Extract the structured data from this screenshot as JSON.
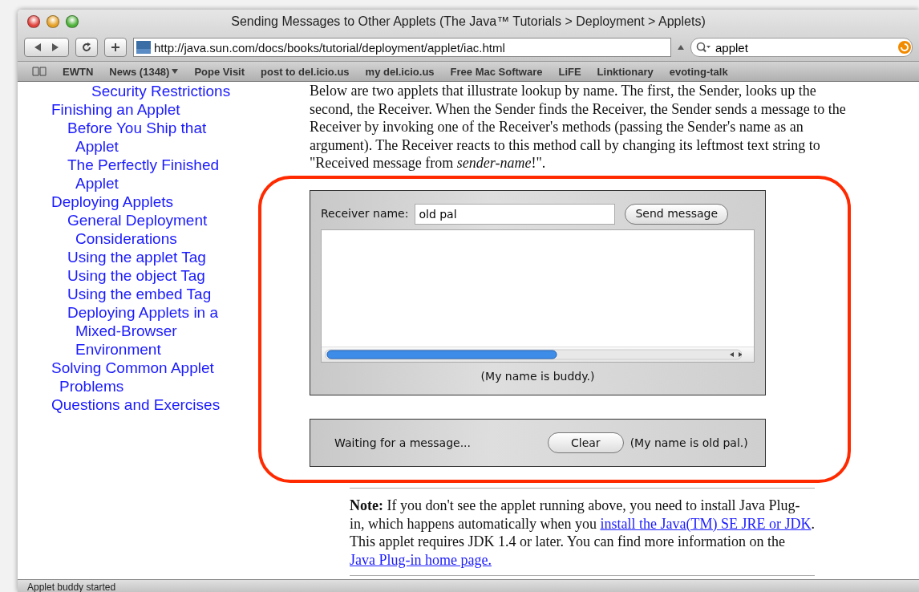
{
  "window": {
    "title": "Sending Messages to Other Applets (The Java™ Tutorials > Deployment > Applets)"
  },
  "toolbar": {
    "url": "http://java.sun.com/docs/books/tutorial/deployment/applet/iac.html",
    "search": "applet"
  },
  "bookmarks": [
    {
      "label": "EWTN",
      "menu": false
    },
    {
      "label": "News (1348)",
      "menu": true
    },
    {
      "label": "Pope Visit",
      "menu": false
    },
    {
      "label": "post to del.icio.us",
      "menu": false
    },
    {
      "label": "my del.icio.us",
      "menu": false
    },
    {
      "label": "Free Mac Software",
      "menu": false
    },
    {
      "label": "LiFE",
      "menu": false
    },
    {
      "label": "Linktionary",
      "menu": false
    },
    {
      "label": "evoting-talk",
      "menu": false
    }
  ],
  "sidebar": {
    "cut_item": "Security Restrictions",
    "items": [
      {
        "label": "Finishing an Applet",
        "children": [
          {
            "label": "Before You Ship that Applet"
          },
          {
            "label": "The Perfectly Finished Applet"
          }
        ]
      },
      {
        "label": "Deploying Applets",
        "children": [
          {
            "label": "General Deployment Considerations"
          },
          {
            "label": "Using the applet Tag"
          },
          {
            "label": "Using the object Tag"
          },
          {
            "label": "Using the embed Tag"
          },
          {
            "label": "Deploying Applets in a Mixed-Browser Environment"
          }
        ]
      },
      {
        "label": "Solving Common Applet Problems"
      },
      {
        "label": "Questions and Exercises"
      }
    ]
  },
  "intro": "Below are two applets that illustrate lookup by name. The first, the Sender, looks up the second, the Receiver. When the Sender finds the Receiver, the Sender sends a message to the Receiver by invoking one of the Receiver's methods (passing the Sender's name as an argument). The Receiver reacts to this method call by changing its leftmost text string to \"Received message from *sender-name*!\".",
  "sender_applet": {
    "label": "Receiver name:",
    "value": "old pal",
    "button": "Send message",
    "caption": "(My name is buddy.)"
  },
  "receiver_applet": {
    "status": "Waiting for a message...",
    "button": "Clear",
    "caption": "(My name is old pal.)"
  },
  "note": [
    {
      "kind": "text",
      "text": "**Note:** If you don't see the applet running above, you need to install Java Plug-in, which happens automatically when you "
    },
    {
      "kind": "link",
      "text": "install the Java(TM) SE JRE or JDK"
    },
    {
      "kind": "text",
      "text": ". This applet requires JDK 1.4 or later. You can find more information on the "
    },
    {
      "kind": "link",
      "text": "Java Plug-in home page."
    }
  ],
  "status_bar": "Applet buddy started"
}
